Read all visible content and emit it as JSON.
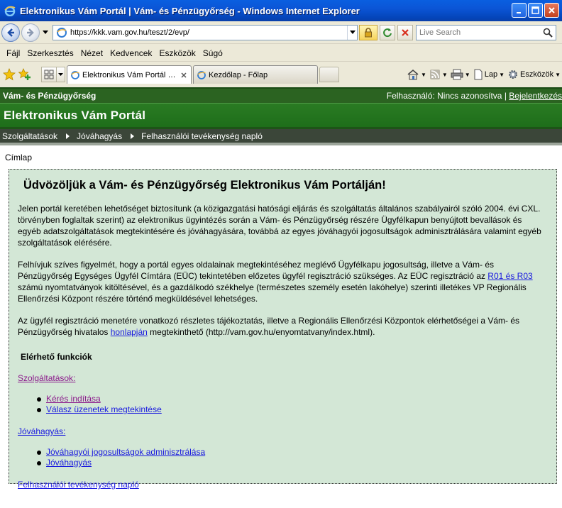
{
  "window": {
    "title": "Elektronikus Vám Portál | Vám- és Pénzügyőrség - Windows Internet Explorer"
  },
  "address_bar": {
    "url": "https://kkk.vam.gov.hu/teszt/2/evp/",
    "search_placeholder": "Live Search"
  },
  "menu": {
    "items": [
      {
        "label": "Fájl"
      },
      {
        "label": "Szerkesztés"
      },
      {
        "label": "Nézet"
      },
      {
        "label": "Kedvencek"
      },
      {
        "label": "Eszközök"
      },
      {
        "label": "Súgó"
      }
    ]
  },
  "tabs": [
    {
      "label": "Elektronikus Vám Portál | ...",
      "active": true
    },
    {
      "label": "Kezdőlap - Főlap",
      "active": false
    }
  ],
  "command_bar": {
    "page_label": "Lap",
    "tools_label": "Eszközök"
  },
  "page": {
    "org_name": "Vám- és Pénzügyőrség",
    "user_prefix": "Felhasználó: Nincs azonosítva | ",
    "login_link": "Bejelentkezés",
    "portal_title": "Elektronikus Vám Portál",
    "nav": [
      {
        "label": "Szolgáltatások"
      },
      {
        "label": "Jóváhagyás"
      },
      {
        "label": "Felhasználói tevékenység napló"
      }
    ],
    "breadcrumb": "Címlap",
    "heading": "Üdvözöljük a Vám- és Pénzügyőrség Elektronikus Vám Portálján!",
    "para1": "Jelen portál keretében lehetőséget biztosítunk (a közigazgatási hatósági eljárás és szolgáltatás általános szabályairól szóló 2004. évi CXL. törvényben foglaltak szerint) az elektronikus ügyintézés során a Vám- és Pénzügyőrség részére Ügyfélkapun benyújtott bevallások és egyéb adatszolgáltatások megtekintésére és jóváhagyására, továbbá az egyes jóváhagyói jogosultságok adminisztrálására valamint egyéb szolgáltatások elérésére.",
    "para2_before": "Felhívjuk szíves figyelmét, hogy a portál egyes oldalainak megtekintéséhez meglévő Ügyfélkapu jogosultság, illetve a Vám- és Pénzügyőrség Egységes Ügyfél Címtára (EÜC) tekintetében előzetes ügyfél regisztráció szükséges. Az EÜC regisztráció az ",
    "para2_link": "R01 és R03",
    "para2_after": " számú nyomtatványok kitöltésével, és a gazdálkodó székhelye (természetes személy esetén lakóhelye) szerinti illetékes VP Regionális Ellenőrzési Központ részére történő megküldésével lehetséges.",
    "para3_before": "Az ügyfél regisztráció menetére vonatkozó részletes tájékoztatás, illetve a Regionális Ellenőrzési Központok elérhetőségei a Vám- és Pénzügyőrség hivatalos ",
    "para3_link": "honlapján",
    "para3_after": " megtekinthető (http://vam.gov.hu/enyomtatvany/index.html).",
    "functions_heading": "Elérhető funkciók",
    "sections": [
      {
        "title": "Szolgáltatások:",
        "items": [
          "Kérés indítása",
          "Válasz üzenetek megtekintése"
        ]
      },
      {
        "title": "Jóváhagyás:",
        "items": [
          "Jóváhagyói jogosultságok adminisztrálása",
          "Jóváhagyás"
        ]
      }
    ],
    "log_link": "Felhasználói tevékenység napló"
  },
  "colors": {
    "green_dark": "#2B6321",
    "green_portal": "#227420",
    "content_bg": "#D3E7D6",
    "link": "#1A1ADF",
    "visited": "#8B1A8B"
  }
}
